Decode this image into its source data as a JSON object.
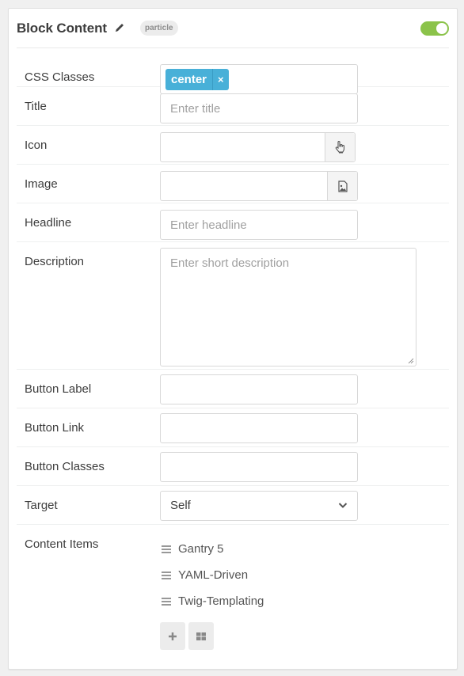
{
  "header": {
    "title": "Block Content",
    "badge": "particle",
    "enabled": true,
    "toggle_color": "#8bc34a"
  },
  "fields": {
    "css_classes": {
      "label": "CSS Classes",
      "tags": [
        "center"
      ],
      "tag_color": "#48b0d8",
      "remove_glyph": "×"
    },
    "title": {
      "label": "Title",
      "value": "",
      "placeholder": "Enter title"
    },
    "icon": {
      "label": "Icon",
      "value": "",
      "picker_icon": "hand-pointer-icon"
    },
    "image": {
      "label": "Image",
      "value": "",
      "picker_icon": "file-image-icon"
    },
    "headline": {
      "label": "Headline",
      "value": "",
      "placeholder": "Enter headline"
    },
    "description": {
      "label": "Description",
      "value": "",
      "placeholder": "Enter short description"
    },
    "button_label": {
      "label": "Button Label",
      "value": ""
    },
    "button_link": {
      "label": "Button Link",
      "value": ""
    },
    "button_classes": {
      "label": "Button Classes",
      "value": ""
    },
    "target": {
      "label": "Target",
      "selected": "Self"
    },
    "content_items": {
      "label": "Content Items",
      "items": [
        "Gantry 5",
        "YAML-Driven",
        "Twig-Templating"
      ]
    }
  }
}
